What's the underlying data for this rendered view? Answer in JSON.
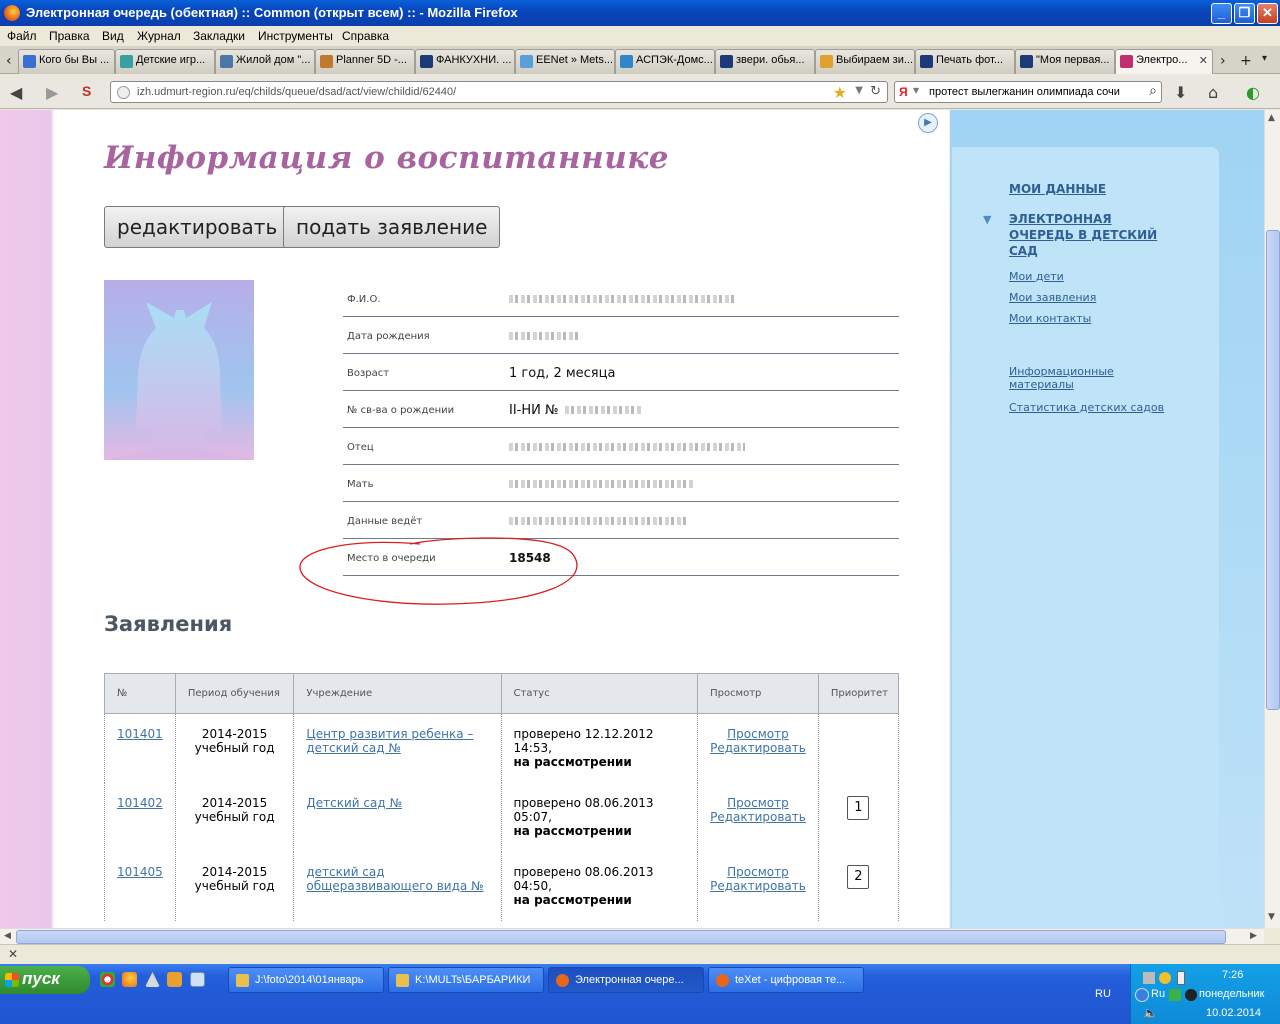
{
  "window": {
    "title": "Электронная очередь (обектная) :: Common (открыт всем) :: - Mozilla Firefox"
  },
  "menu": [
    "Файл",
    "Правка",
    "Вид",
    "Журнал",
    "Закладки",
    "Инструменты",
    "Справка"
  ],
  "tabs": [
    {
      "label": "Кого бы Вы ...",
      "color": "#3a6fd1"
    },
    {
      "label": "Детские игр...",
      "color": "#38a0a0"
    },
    {
      "label": "Жилой дом \"...",
      "color": "#4a76a8"
    },
    {
      "label": "Planner 5D -...",
      "color": "#c07a30"
    },
    {
      "label": "ФАНКУХНИ. ...",
      "color": "#1c3a78"
    },
    {
      "label": "EENet » Mets...",
      "color": "#5aa0d8"
    },
    {
      "label": "АСПЭК-Домс...",
      "color": "#2f86c8"
    },
    {
      "label": "звери. обья...",
      "color": "#1c3a78"
    },
    {
      "label": "Выбираем зи...",
      "color": "#e0a030"
    },
    {
      "label": "Печать фот...",
      "color": "#1c3a78"
    },
    {
      "label": "\"Моя первая...",
      "color": "#1c3a78"
    },
    {
      "label": "Электро...",
      "color": "#c03070"
    }
  ],
  "nav": {
    "url": "izh.udmurt-region.ru/eq/childs/queue/dsad/act/view/childid/62440/",
    "search_engine": "Я",
    "search_value": "протест вылегжанин олимпиада сочи"
  },
  "page": {
    "title": "Информация о воспитаннике",
    "buttons": {
      "edit": "редактировать",
      "apply": "подать заявление"
    },
    "info_rows": [
      {
        "label": "Ф.И.О.",
        "value": "",
        "hidden": true
      },
      {
        "label": "Дата рождения",
        "value": "",
        "hidden": true
      },
      {
        "label": "Возраст",
        "value": "1 год, 2 месяца",
        "hidden": false
      },
      {
        "label": "№ св-ва о рождении",
        "value": "II-НИ №",
        "hidden": true
      },
      {
        "label": "Отец",
        "value": "",
        "hidden": true
      },
      {
        "label": "Мать",
        "value": "",
        "hidden": true
      },
      {
        "label": "Данные ведёт",
        "value": "",
        "hidden": true
      },
      {
        "label": "Место в очереди",
        "value": "18548",
        "hidden": false
      }
    ],
    "apps_heading": "Заявления",
    "table": {
      "headers": [
        "№",
        "Период обучения",
        "Учреждение",
        "Статус",
        "Просмотр",
        "Приоритет"
      ],
      "rows": [
        {
          "num": "101401",
          "period": "2014-2015 учебный год",
          "institution": "Центр развития ребенка – детский сад №",
          "status_line": "проверено 12.12.2012 14:53,",
          "status_bold": "на рассмотрении",
          "view": "Просмотр",
          "edit": "Редактировать",
          "priority": ""
        },
        {
          "num": "101402",
          "period": "2014-2015 учебный год",
          "institution": "Детский сад №",
          "status_line": "проверено 08.06.2013 05:07,",
          "status_bold": "на рассмотрении",
          "view": "Просмотр",
          "edit": "Редактировать",
          "priority": "1"
        },
        {
          "num": "101405",
          "period": "2014-2015 учебный год",
          "institution": "детский сад общеразвивающего вида №",
          "status_line": "проверено 08.06.2013 04:50,",
          "status_bold": "на рассмотрении",
          "view": "Просмотр",
          "edit": "Редактировать",
          "priority": "2"
        }
      ]
    }
  },
  "sidebar": {
    "my_data": "МОИ ДАННЫЕ",
    "queue": "ЭЛЕКТРОННАЯ ОЧЕРЕДЬ В ДЕТСКИЙ САД",
    "links": [
      "Мои дети",
      "Мои заявления",
      "Мои контакты"
    ],
    "info": "Информационные материалы",
    "stats": "Статистика детских садов"
  },
  "taskbar": {
    "start": "пуск",
    "buttons": [
      {
        "label": "J:\\foto\\2014\\01январь",
        "color": "#e8c050"
      },
      {
        "label": "K:\\MULTs\\БАРБАРИКИ",
        "color": "#e8c050"
      },
      {
        "label": "Электронная очере...",
        "color": "#e8661c"
      },
      {
        "label": "teXet - цифровая те...",
        "color": "#e8661c"
      }
    ],
    "lang": "RU",
    "tray_lang": "Ru",
    "time": "7:26",
    "weekday": "понедельник",
    "date": "10.02.2014"
  }
}
